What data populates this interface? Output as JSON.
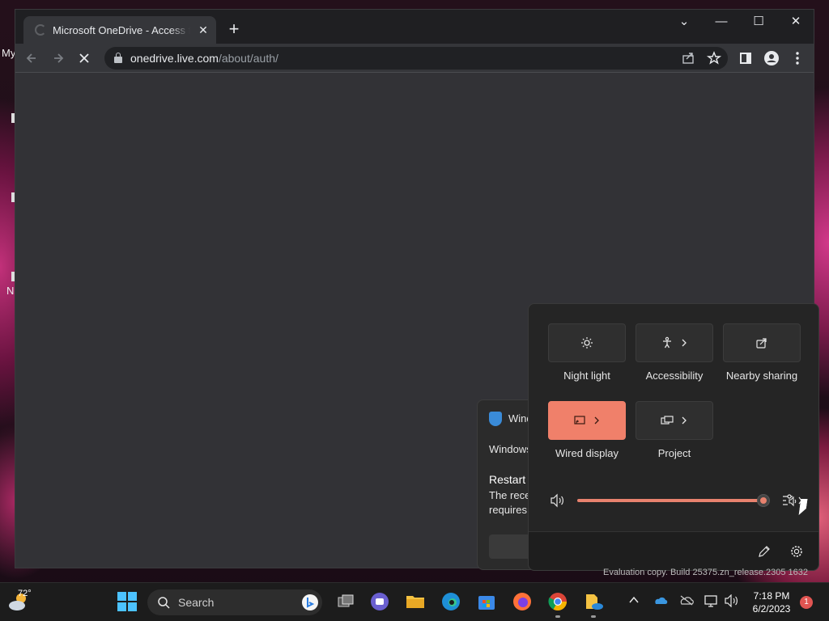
{
  "desktop": {
    "icon_texts": [
      "My",
      "N"
    ]
  },
  "browser": {
    "tab_title": "Microsoft OneDrive - Access files",
    "tab_close": "✕",
    "new_tab": "+",
    "url_host": "onedrive.live.com",
    "url_path": "/about/auth/",
    "window_controls": {
      "list": "⌄",
      "minimize": "—",
      "maximize": "☐",
      "close": "✕"
    }
  },
  "toast": {
    "title": "Wind",
    "source": "Windows",
    "heading": "Restart t",
    "body_line1": "The rece",
    "body_line2": "requires"
  },
  "quick_settings": {
    "tiles": [
      {
        "label": "Night light",
        "icon": "sun-icon",
        "has_chevron": false,
        "on": false
      },
      {
        "label": "Accessibility",
        "icon": "accessibility-icon",
        "has_chevron": true,
        "on": false
      },
      {
        "label": "Nearby sharing",
        "icon": "share-icon",
        "has_chevron": false,
        "on": false
      },
      {
        "label": "Wired display",
        "icon": "cast-icon",
        "has_chevron": true,
        "on": true
      },
      {
        "label": "Project",
        "icon": "project-icon",
        "has_chevron": true,
        "on": false
      }
    ],
    "volume_fraction": 0.98,
    "accent_color": "#f0806a"
  },
  "watermark": "Evaluation copy. Build 25375.zn_release.2305 1632",
  "taskbar": {
    "weather_temp": "72°",
    "search_placeholder": "Search",
    "time": "7:18 PM",
    "date": "6/2/2023",
    "notification_count": "1"
  }
}
